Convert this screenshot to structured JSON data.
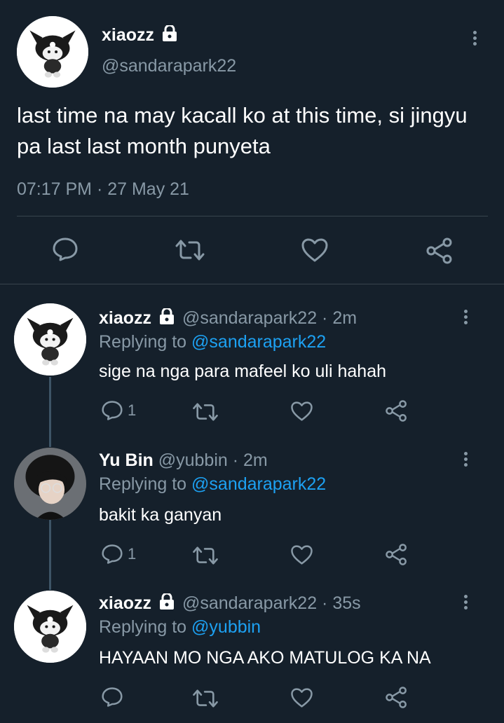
{
  "main_tweet": {
    "display_name": "xiaozz",
    "handle": "@sandarapark22",
    "text": "last time na may kacall ko at this time, si jingyu pa last last month punyeta",
    "timestamp": "07:17 PM · 27 May 21"
  },
  "replies": [
    {
      "display_name": "xiaozz",
      "handle_time": "@sandarapark22 · 2m",
      "replying_label": "Replying to",
      "replying_to": "@sandarapark22",
      "text": "sige na nga para mafeel ko uli hahah",
      "reply_count": "1"
    },
    {
      "display_name": "Yu Bin",
      "handle_time": "@yubbin · 2m",
      "replying_label": "Replying to",
      "replying_to": "@sandarapark22",
      "text": "bakit ka ganyan",
      "reply_count": "1"
    },
    {
      "display_name": "xiaozz",
      "handle_time": "@sandarapark22 · 35s",
      "replying_label": "Replying to",
      "replying_to": "@yubbin",
      "text": "HAYAAN MO NGA AKO MATULOG KA NA",
      "reply_count": ""
    }
  ],
  "colors": {
    "background": "#15202b",
    "muted": "#8899a6",
    "link": "#1da1f2",
    "divider": "#38444d"
  },
  "icons": [
    "lock-icon",
    "more-icon",
    "reply-icon",
    "retweet-icon",
    "like-icon",
    "share-icon"
  ]
}
